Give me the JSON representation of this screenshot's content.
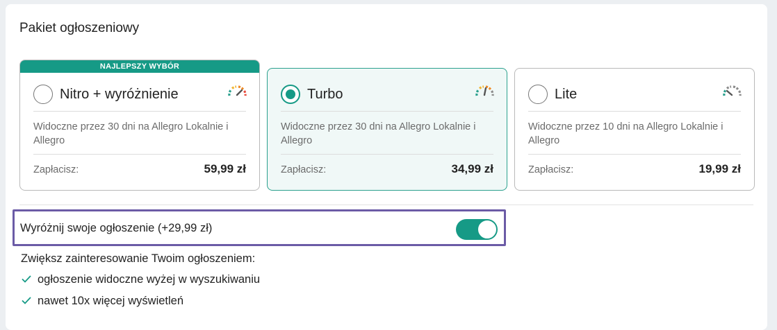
{
  "section_title": "Pakiet ogłoszeniowy",
  "packages": [
    {
      "badge": "NAJLEPSZY WYBÓR",
      "name": "Nitro + wyróżnienie",
      "description": "Widoczne przez 30 dni na Allegro Lokalnie i Allegro",
      "pay_label": "Zapłacisz:",
      "price": "59,99 zł",
      "selected": false,
      "icon": "speed-gauge-high-icon"
    },
    {
      "name": "Turbo",
      "description": "Widoczne przez 30 dni na Allegro Lokalnie i Allegro",
      "pay_label": "Zapłacisz:",
      "price": "34,99 zł",
      "selected": true,
      "icon": "speed-gauge-medium-icon"
    },
    {
      "name": "Lite",
      "description": "Widoczne przez 10 dni na Allegro Lokalnie i Allegro",
      "pay_label": "Zapłacisz:",
      "price": "19,99 zł",
      "selected": false,
      "icon": "speed-gauge-low-icon"
    }
  ],
  "highlight": {
    "label": "Wyróżnij swoje ogłoszenie (+29,99 zł)",
    "enabled": true
  },
  "promo": {
    "heading": "Zwiększ zainteresowanie Twoim ogłoszeniem:",
    "benefits": [
      "ogłoszenie widoczne wyżej w wyszukiwaniu",
      "nawet 10x więcej wyświetleń"
    ]
  },
  "colors": {
    "accent": "#169a86",
    "highlight_border": "#6b5ba6",
    "selected_bg": "#f0f8f7"
  }
}
